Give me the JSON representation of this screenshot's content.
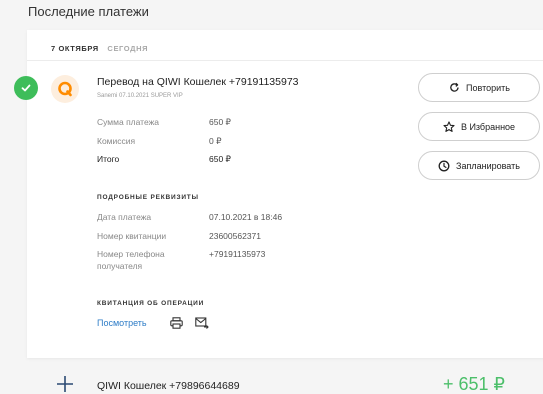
{
  "page": {
    "heading": "Последние платежи"
  },
  "card": {
    "date_main": "7 ОКТЯБРЯ",
    "date_relative": "СЕГОДНЯ",
    "payment": {
      "title": "Перевод на QIWI Кошелек +79191135973",
      "subtitle": "Sanemi 07.10.2021 SUPER VIP",
      "amount_label": "Сумма платежа",
      "amount_value": "650 ₽",
      "fee_label": "Комиссия",
      "fee_value": "0 ₽",
      "total_label": "Итого",
      "total_value": "650 ₽"
    },
    "details": {
      "section_title": "ПОДРОБНЫЕ РЕКВИЗИТЫ",
      "date_label": "Дата платежа",
      "date_value": "07.10.2021 в 18:46",
      "receipt_label": "Номер квитанции",
      "receipt_value": "23600562371",
      "phone_label_line1": "Номер телефона",
      "phone_label_line2": "получателя",
      "phone_value": "+79191135973"
    },
    "receipt": {
      "section_title": "КВИТАНЦИЯ ОБ ОПЕРАЦИИ",
      "view_link": "Посмотреть"
    },
    "actions": {
      "repeat": "Повторить",
      "favorite": "В Избранное",
      "schedule": "Запланировать"
    },
    "icons": {
      "status": "check-circle-icon",
      "provider": "qiwi-logo-icon",
      "print": "printer-icon",
      "email": "mail-forward-icon",
      "repeat": "repeat-icon",
      "favorite": "star-icon",
      "schedule": "clock-icon"
    }
  },
  "second_item": {
    "title": "QIWI Кошелек +79896644689",
    "amount": "+ 651 ₽"
  },
  "colors": {
    "success": "#3ebd5a",
    "link": "#2d7cc7",
    "income": "#4cbf6a",
    "qiwi_orange": "#ff8c00"
  }
}
